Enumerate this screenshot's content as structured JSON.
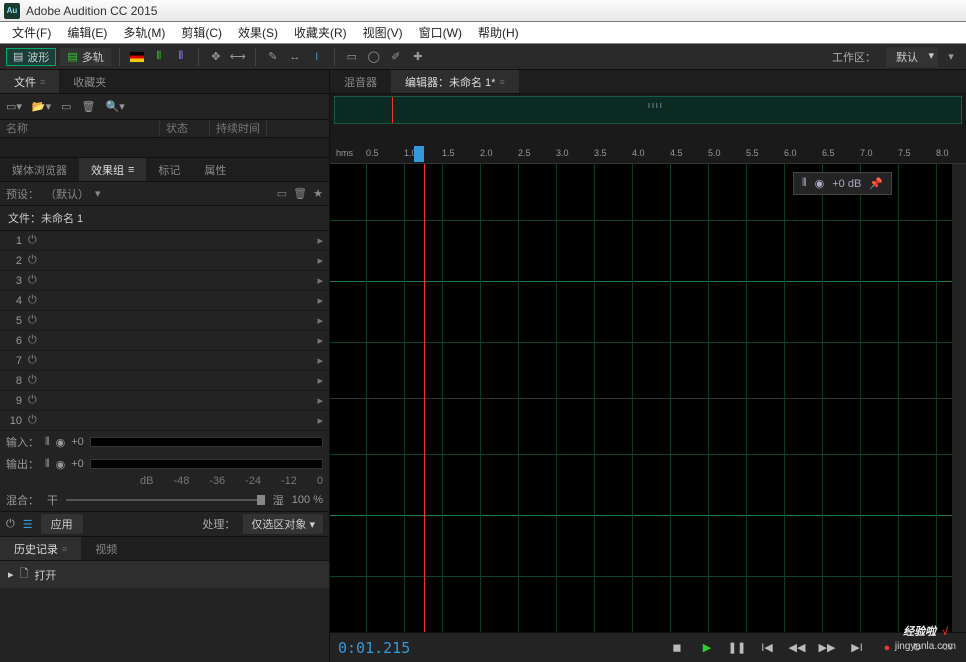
{
  "title": "Adobe Audition CC 2015",
  "menu": [
    "文件(F)",
    "编辑(E)",
    "多轨(M)",
    "剪辑(C)",
    "效果(S)",
    "收藏夹(R)",
    "视图(V)",
    "窗口(W)",
    "帮助(H)"
  ],
  "toolbar": {
    "waveform": "波形",
    "multitrack": "多轨",
    "workspace_label": "工作区：",
    "workspace_value": "默认"
  },
  "left": {
    "tabs_top": {
      "files": "文件",
      "favorites": "收藏夹"
    },
    "file_cols": {
      "name": "名称",
      "status": "状态",
      "duration": "持续时间"
    },
    "tabs_mid": {
      "media": "媒体浏览器",
      "fx": "效果组",
      "markers": "标记",
      "props": "属性"
    },
    "preset_label": "预设：",
    "preset_value": "（默认）",
    "file_label": "文件：未命名 1",
    "slots": [
      "1",
      "2",
      "3",
      "4",
      "5",
      "6",
      "7",
      "8",
      "9",
      "10"
    ],
    "input_label": "输入：",
    "output_label": "输出：",
    "io_value": "+0",
    "db_ticks": [
      "dB",
      "-48",
      "-36",
      "-24",
      "-12",
      "0"
    ],
    "mix_label": "混合：",
    "dry": "干",
    "wet": "湿",
    "mix_value": "100 %",
    "apply": "应用",
    "process_label": "处理：",
    "process_value": "仅选区对象",
    "tabs_bottom": {
      "history": "历史记录",
      "video": "视频"
    },
    "history_open": "打开"
  },
  "right": {
    "mixer_tab": "混音器",
    "editor_tab": "编辑器：未命名 1*",
    "ruler_unit": "hms",
    "ruler_ticks": [
      "0.5",
      "1.0",
      "1.5",
      "2.0",
      "2.5",
      "3.0",
      "3.5",
      "4.0",
      "4.5",
      "5.0",
      "5.5",
      "6.0",
      "6.5",
      "7.0",
      "7.5",
      "8.0"
    ],
    "hud_db": "+0 dB",
    "timecode": "0:01.215"
  },
  "watermark": {
    "line1a": "经验啦",
    "line1b": "√",
    "line2": "jingyanla.com"
  }
}
